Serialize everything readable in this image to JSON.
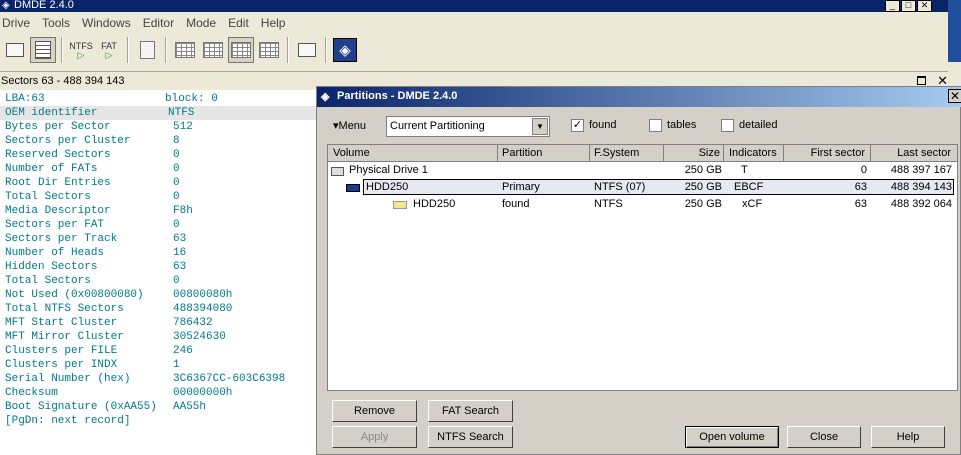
{
  "app": {
    "title": "DMDE 2.4.0"
  },
  "menu": [
    "Drive",
    "Tools",
    "Windows",
    "Editor",
    "Mode",
    "Edit",
    "Help"
  ],
  "toolbar": {
    "ntfs_label": "NTFS",
    "fat_label": "FAT"
  },
  "sectors_bar": {
    "text": "Sectors 63 - 488 394 143"
  },
  "sector_view": {
    "lba": "LBA:63",
    "block": "block: 0",
    "rows": [
      {
        "key": "OEM identifier",
        "value": "NTFS"
      },
      {
        "key": "Bytes per Sector",
        "value": "512"
      },
      {
        "key": "Sectors per Cluster",
        "value": "8"
      },
      {
        "key": "Reserved Sectors",
        "value": "0"
      },
      {
        "key": "Number of FATs",
        "value": "0"
      },
      {
        "key": "Root Dir Entries",
        "value": "0"
      },
      {
        "key": "Total Sectors",
        "value": "0"
      },
      {
        "key": "Media Descriptor",
        "value": "F8h"
      },
      {
        "key": "Sectors per FAT",
        "value": "0"
      },
      {
        "key": "Sectors per Track",
        "value": "63"
      },
      {
        "key": "Number of Heads",
        "value": "16"
      },
      {
        "key": "Hidden Sectors",
        "value": "63"
      },
      {
        "key": "Total Sectors",
        "value": "0"
      },
      {
        "key": "Not Used (0x00800080)",
        "value": "00800080h"
      },
      {
        "key": "Total NTFS Sectors",
        "value": "488394080"
      },
      {
        "key": "MFT Start Cluster",
        "value": "786432"
      },
      {
        "key": "MFT Mirror Cluster",
        "value": "30524630"
      },
      {
        "key": "Clusters per FILE",
        "value": "246"
      },
      {
        "key": "Clusters per INDX",
        "value": "1"
      },
      {
        "key": "Serial Number (hex)",
        "value": "3C6367CC-603C6398"
      },
      {
        "key": "Checksum",
        "value": "00000000h"
      },
      {
        "key": "Boot Signature (0xAA55)",
        "value": "AA55h"
      }
    ],
    "footer": "[PgDn: next record]"
  },
  "partitions_dialog": {
    "title": "Partitions - DMDE 2.4.0",
    "menu_label": "Menu",
    "combo_value": "Current Partitioning",
    "options": [
      {
        "label": "found",
        "checked": true
      },
      {
        "label": "tables",
        "checked": false
      },
      {
        "label": "detailed",
        "checked": false
      }
    ],
    "columns": [
      "Volume",
      "Partition",
      "F.System",
      "Size",
      "Indicators",
      "First sector",
      "Last sector"
    ],
    "rows": [
      {
        "volume": "Physical Drive 1",
        "partition": "",
        "fsystem": "",
        "size": "250 GB",
        "indicators": "T",
        "first": "0",
        "last": "488 397 167"
      },
      {
        "volume": "HDD250",
        "partition": "Primary",
        "fsystem": "NTFS (07)",
        "size": "250 GB",
        "indicators": "EBCF",
        "first": "63",
        "last": "488 394 143"
      },
      {
        "volume": "HDD250",
        "partition": "found",
        "fsystem": "NTFS",
        "size": "250 GB",
        "indicators": "xCF",
        "first": "63",
        "last": "488 392 064"
      }
    ],
    "buttons": {
      "remove": "Remove",
      "fat_search": "FAT Search",
      "apply": "Apply",
      "ntfs_search": "NTFS Search",
      "open_volume": "Open volume",
      "close": "Close",
      "help": "Help"
    }
  }
}
